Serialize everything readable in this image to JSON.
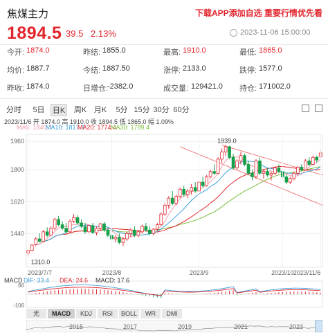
{
  "header": {
    "title": "焦煤主力",
    "promo": "下载APP添加自选 重要行情优先看",
    "price": "1894.5",
    "change": "39.5",
    "change_pct": "2.13%",
    "status": "2023-11-06 15:00:00"
  },
  "stats": [
    {
      "label": "今开:",
      "value": "1874.0",
      "color": "red"
    },
    {
      "label": "昨结:",
      "value": "1855.0",
      "color": "default"
    },
    {
      "label": "最高:",
      "value": "1910.0",
      "color": "red"
    },
    {
      "label": "最低:",
      "value": "1865.0",
      "color": "red"
    },
    {
      "label": "均价:",
      "value": "1887.7",
      "color": "default"
    },
    {
      "label": "今结:",
      "value": "1887.50",
      "color": "default"
    },
    {
      "label": "涨停:",
      "value": "2133.0",
      "color": "default"
    },
    {
      "label": "跌停:",
      "value": "1577.0",
      "color": "default"
    },
    {
      "label": "昨收:",
      "value": "1874.0",
      "color": "default"
    },
    {
      "label": "日增仓:",
      "value": "-2382.0",
      "color": "default"
    },
    {
      "label": "成交量:",
      "value": "129421.0",
      "color": "default"
    },
    {
      "label": "持仓:",
      "value": "171002.0",
      "color": "default"
    }
  ],
  "period_tabs": [
    "分时",
    "5日",
    "日K",
    "周K",
    "月K",
    "5分",
    "15分",
    "30分",
    "60分"
  ],
  "active_period": "日K",
  "toolbar_icons": [
    "crosshair-icon",
    "fullscreen-icon"
  ],
  "bar_info": "2023/11/6  开 1874.0  高 1910.0  收 1894.5  低 1865.0  幅 1.09%",
  "ma": [
    {
      "label": "MA5: 1840.7",
      "color": "#f0a0b0"
    },
    {
      "label": "MA10: 1817.3",
      "color": "#3a9fd8"
    },
    {
      "label": "MA20: 1774.4",
      "color": "#e3262e"
    },
    {
      "label": "MA30: 1799.4",
      "color": "#7cbd3c"
    }
  ],
  "macd": [
    {
      "label": "MACD",
      "color": "#333"
    },
    {
      "label": "DIF: 33.4",
      "color": "#3a9fd8"
    },
    {
      "label": "DEA: 24.6",
      "color": "#e3262e"
    },
    {
      "label": "MACD: 17.6",
      "color": "#333"
    }
  ],
  "indicator_tabs": [
    "无",
    "MACD",
    "KDJ",
    "RSI",
    "BOLL",
    "WR",
    "DMI"
  ],
  "active_indicator": "MACD",
  "timeline_years": [
    "2015",
    "2017",
    "2019",
    "2021",
    "2023"
  ],
  "chart_data": {
    "type": "candlestick",
    "title": "",
    "xlabel": "",
    "ylabel": "",
    "ylim": [
      1250,
      2000
    ],
    "y_ticks": [
      1960,
      1800,
      1620,
      1440
    ],
    "x_ticks": [
      "2023/7/7",
      "2023/8",
      "2023/9",
      "2023/10",
      "2023/11/6"
    ],
    "annotations": [
      {
        "text": "1939.0",
        "type": "max"
      },
      {
        "text": "1310.0",
        "type": "min"
      }
    ],
    "candles": [
      {
        "o": 1330,
        "h": 1350,
        "l": 1310,
        "c": 1345
      },
      {
        "o": 1345,
        "h": 1380,
        "l": 1340,
        "c": 1375
      },
      {
        "o": 1378,
        "h": 1420,
        "l": 1370,
        "c": 1410
      },
      {
        "o": 1410,
        "h": 1440,
        "l": 1390,
        "c": 1395
      },
      {
        "o": 1395,
        "h": 1460,
        "l": 1390,
        "c": 1450
      },
      {
        "o": 1450,
        "h": 1475,
        "l": 1420,
        "c": 1430
      },
      {
        "o": 1430,
        "h": 1480,
        "l": 1425,
        "c": 1470
      },
      {
        "o": 1470,
        "h": 1530,
        "l": 1460,
        "c": 1520
      },
      {
        "o": 1520,
        "h": 1540,
        "l": 1480,
        "c": 1490
      },
      {
        "o": 1490,
        "h": 1510,
        "l": 1460,
        "c": 1470
      },
      {
        "o": 1470,
        "h": 1500,
        "l": 1440,
        "c": 1450
      },
      {
        "o": 1450,
        "h": 1520,
        "l": 1445,
        "c": 1510
      },
      {
        "o": 1510,
        "h": 1550,
        "l": 1500,
        "c": 1530
      },
      {
        "o": 1530,
        "h": 1545,
        "l": 1490,
        "c": 1500
      },
      {
        "o": 1500,
        "h": 1520,
        "l": 1470,
        "c": 1480
      },
      {
        "o": 1480,
        "h": 1500,
        "l": 1440,
        "c": 1450
      },
      {
        "o": 1450,
        "h": 1490,
        "l": 1445,
        "c": 1485
      },
      {
        "o": 1485,
        "h": 1500,
        "l": 1440,
        "c": 1445
      },
      {
        "o": 1445,
        "h": 1480,
        "l": 1430,
        "c": 1470
      },
      {
        "o": 1470,
        "h": 1500,
        "l": 1455,
        "c": 1495
      },
      {
        "o": 1495,
        "h": 1505,
        "l": 1450,
        "c": 1460
      },
      {
        "o": 1460,
        "h": 1470,
        "l": 1420,
        "c": 1430
      },
      {
        "o": 1430,
        "h": 1450,
        "l": 1400,
        "c": 1410
      },
      {
        "o": 1410,
        "h": 1430,
        "l": 1390,
        "c": 1420
      },
      {
        "o": 1420,
        "h": 1440,
        "l": 1380,
        "c": 1390
      },
      {
        "o": 1390,
        "h": 1420,
        "l": 1370,
        "c": 1410
      },
      {
        "o": 1410,
        "h": 1450,
        "l": 1400,
        "c": 1440
      },
      {
        "o": 1440,
        "h": 1470,
        "l": 1420,
        "c": 1460
      },
      {
        "o": 1460,
        "h": 1480,
        "l": 1420,
        "c": 1430
      },
      {
        "o": 1430,
        "h": 1460,
        "l": 1420,
        "c": 1450
      },
      {
        "o": 1450,
        "h": 1490,
        "l": 1440,
        "c": 1480
      },
      {
        "o": 1480,
        "h": 1500,
        "l": 1450,
        "c": 1460
      },
      {
        "o": 1460,
        "h": 1480,
        "l": 1430,
        "c": 1440
      },
      {
        "o": 1440,
        "h": 1470,
        "l": 1430,
        "c": 1465
      },
      {
        "o": 1465,
        "h": 1500,
        "l": 1455,
        "c": 1490
      },
      {
        "o": 1490,
        "h": 1560,
        "l": 1485,
        "c": 1550
      },
      {
        "o": 1550,
        "h": 1610,
        "l": 1540,
        "c": 1600
      },
      {
        "o": 1600,
        "h": 1650,
        "l": 1580,
        "c": 1640
      },
      {
        "o": 1640,
        "h": 1680,
        "l": 1600,
        "c": 1610
      },
      {
        "o": 1610,
        "h": 1660,
        "l": 1600,
        "c": 1650
      },
      {
        "o": 1650,
        "h": 1700,
        "l": 1640,
        "c": 1690
      },
      {
        "o": 1690,
        "h": 1710,
        "l": 1650,
        "c": 1660
      },
      {
        "o": 1660,
        "h": 1690,
        "l": 1640,
        "c": 1680
      },
      {
        "o": 1680,
        "h": 1720,
        "l": 1660,
        "c": 1700
      },
      {
        "o": 1700,
        "h": 1730,
        "l": 1670,
        "c": 1680
      },
      {
        "o": 1680,
        "h": 1740,
        "l": 1675,
        "c": 1730
      },
      {
        "o": 1730,
        "h": 1760,
        "l": 1700,
        "c": 1710
      },
      {
        "o": 1710,
        "h": 1770,
        "l": 1705,
        "c": 1760
      },
      {
        "o": 1760,
        "h": 1800,
        "l": 1750,
        "c": 1790
      },
      {
        "o": 1790,
        "h": 1830,
        "l": 1770,
        "c": 1780
      },
      {
        "o": 1780,
        "h": 1870,
        "l": 1775,
        "c": 1860
      },
      {
        "o": 1860,
        "h": 1920,
        "l": 1840,
        "c": 1900
      },
      {
        "o": 1900,
        "h": 1939,
        "l": 1880,
        "c": 1930
      },
      {
        "o": 1930,
        "h": 1935,
        "l": 1860,
        "c": 1870
      },
      {
        "o": 1870,
        "h": 1890,
        "l": 1800,
        "c": 1810
      },
      {
        "o": 1810,
        "h": 1860,
        "l": 1800,
        "c": 1850
      },
      {
        "o": 1850,
        "h": 1900,
        "l": 1830,
        "c": 1880
      },
      {
        "o": 1880,
        "h": 1890,
        "l": 1820,
        "c": 1830
      },
      {
        "o": 1830,
        "h": 1850,
        "l": 1770,
        "c": 1780
      },
      {
        "o": 1780,
        "h": 1800,
        "l": 1740,
        "c": 1760
      },
      {
        "o": 1760,
        "h": 1860,
        "l": 1750,
        "c": 1850
      },
      {
        "o": 1850,
        "h": 1870,
        "l": 1770,
        "c": 1780
      },
      {
        "o": 1780,
        "h": 1800,
        "l": 1750,
        "c": 1790
      },
      {
        "o": 1790,
        "h": 1810,
        "l": 1760,
        "c": 1770
      },
      {
        "o": 1770,
        "h": 1790,
        "l": 1740,
        "c": 1780
      },
      {
        "o": 1780,
        "h": 1820,
        "l": 1770,
        "c": 1810
      },
      {
        "o": 1810,
        "h": 1830,
        "l": 1780,
        "c": 1790
      },
      {
        "o": 1790,
        "h": 1800,
        "l": 1750,
        "c": 1760
      },
      {
        "o": 1760,
        "h": 1770,
        "l": 1720,
        "c": 1730
      },
      {
        "o": 1730,
        "h": 1760,
        "l": 1720,
        "c": 1750
      },
      {
        "o": 1750,
        "h": 1790,
        "l": 1740,
        "c": 1780
      },
      {
        "o": 1780,
        "h": 1820,
        "l": 1770,
        "c": 1815
      },
      {
        "o": 1815,
        "h": 1830,
        "l": 1790,
        "c": 1800
      },
      {
        "o": 1800,
        "h": 1860,
        "l": 1795,
        "c": 1850
      },
      {
        "o": 1850,
        "h": 1870,
        "l": 1820,
        "c": 1830
      },
      {
        "o": 1830,
        "h": 1880,
        "l": 1825,
        "c": 1870
      },
      {
        "o": 1870,
        "h": 1880,
        "l": 1840,
        "c": 1855
      },
      {
        "o": 1874,
        "h": 1910,
        "l": 1865,
        "c": 1894.5
      }
    ]
  }
}
